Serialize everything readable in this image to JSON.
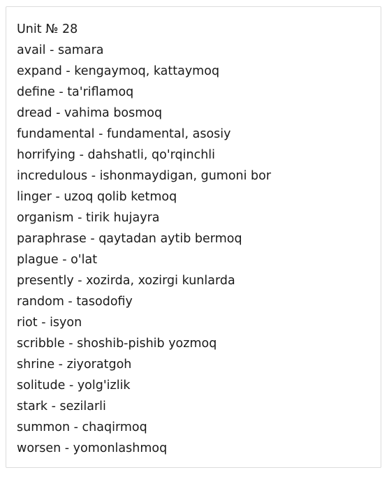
{
  "title": "Unit № 28",
  "entries": [
    "avail - samara",
    "expand - kengaymoq, kattaymoq",
    "define - ta'riflamoq",
    "dread - vahima bosmoq",
    "fundamental - fundamental, asosiy",
    "horrifying - dahshatli, qo'rqinchli",
    "incredulous - ishonmaydigan, gumoni bor",
    "linger - uzoq qolib ketmoq",
    "organism - tirik hujayra",
    "paraphrase - qaytadan aytib bermoq",
    "plague - o'lat",
    "presently - xozirda, xozirgi kunlarda",
    "random - tasodofiy",
    "riot - isyon",
    "scribble - shoshib-pishib yozmoq",
    "shrine - ziyoratgoh",
    "solitude - yolg'izlik",
    "stark - sezilarli",
    "summon - chaqirmoq",
    "worsen - yomonlashmoq"
  ]
}
